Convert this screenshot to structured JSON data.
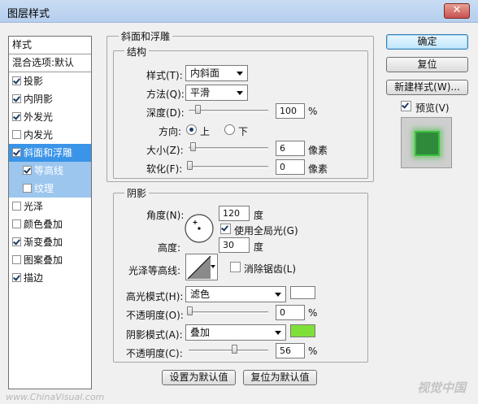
{
  "window": {
    "title": "图层样式",
    "close_symbol": "✕"
  },
  "sidebar": {
    "header": "样式",
    "blend_defaults": "混合选项:默认",
    "items": [
      {
        "label": "投影",
        "checked": true
      },
      {
        "label": "内阴影",
        "checked": true
      },
      {
        "label": "外发光",
        "checked": true
      },
      {
        "label": "内发光",
        "checked": false
      },
      {
        "label": "斜面和浮雕",
        "checked": true,
        "selected": true
      },
      {
        "label": "等高线",
        "checked": true,
        "sub": true
      },
      {
        "label": "纹理",
        "checked": false,
        "sub": true
      },
      {
        "label": "光泽",
        "checked": false
      },
      {
        "label": "颜色叠加",
        "checked": false
      },
      {
        "label": "渐变叠加",
        "checked": true
      },
      {
        "label": "图案叠加",
        "checked": false
      },
      {
        "label": "描边",
        "checked": true
      }
    ]
  },
  "bevel": {
    "group_title": "斜面和浮雕",
    "structure_title": "结构",
    "style_label": "样式(T):",
    "style_value": "内斜面",
    "technique_label": "方法(Q):",
    "technique_value": "平滑",
    "depth_label": "深度(D):",
    "depth_value": "100",
    "depth_unit": "%",
    "depth_fraction": 0.1,
    "direction_label": "方向:",
    "direction_up": "上",
    "direction_down": "下",
    "size_label": "大小(Z):",
    "size_value": "6",
    "size_unit": "像素",
    "size_fraction": 0.04,
    "soften_label": "软化(F):",
    "soften_value": "0",
    "soften_unit": "像素",
    "soften_fraction": 0.0
  },
  "shading": {
    "title": "阴影",
    "angle_label": "角度(N):",
    "angle_value": "120",
    "angle_unit": "度",
    "global_light_label": "使用全局光(G)",
    "global_light_checked": true,
    "altitude_label": "高度:",
    "altitude_value": "30",
    "altitude_unit": "度",
    "gloss_label": "光泽等高线:",
    "antialias_label": "消除锯齿(L)",
    "antialias_checked": false,
    "highlight_mode_label": "高光模式(H):",
    "highlight_mode_value": "滤色",
    "highlight_color": "#ffffff",
    "highlight_opacity_label": "不透明度(O):",
    "highlight_opacity_value": "0",
    "highlight_opacity_unit": "%",
    "highlight_opacity_fraction": 0.0,
    "shadow_mode_label": "阴影模式(A):",
    "shadow_mode_value": "叠加",
    "shadow_color": "#7fe03a",
    "shadow_opacity_label": "不透明度(C):",
    "shadow_opacity_value": "56",
    "shadow_opacity_unit": "%",
    "shadow_opacity_fraction": 0.56
  },
  "footer": {
    "make_default": "设置为默认值",
    "reset_default": "复位为默认值"
  },
  "buttons": {
    "ok": "确定",
    "reset": "复位",
    "new_style": "新建样式(W)...",
    "preview_label": "预览(V)",
    "preview_checked": true
  },
  "preview": {
    "swatch_color": "#2f8a3c"
  },
  "watermark": {
    "left": "www.ChinaVisual.com",
    "right": "视觉中国"
  }
}
